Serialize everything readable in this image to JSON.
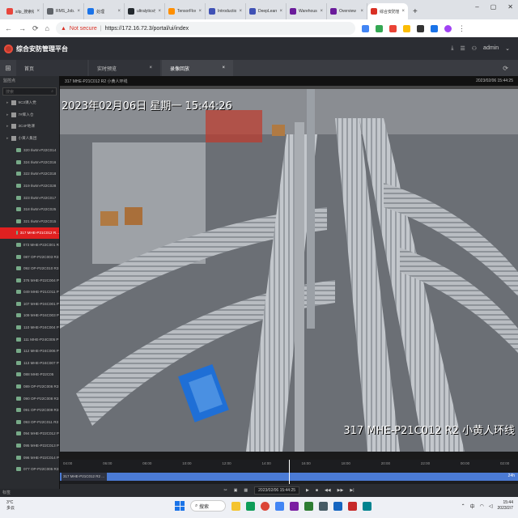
{
  "browser": {
    "tabs": [
      {
        "label": "silp_搜索结果",
        "color": "#e8453c"
      },
      {
        "label": "RMS_Job...",
        "color": "#5f6368"
      },
      {
        "label": "处理",
        "color": "#1a73e8"
      },
      {
        "label": "ultralytics/y...",
        "color": "#24292e"
      },
      {
        "label": "TensorFlow",
        "color": "#ff8f00"
      },
      {
        "label": "Introductio...",
        "color": "#3f51b5"
      },
      {
        "label": "DeepLearni...",
        "color": "#3f51b5"
      },
      {
        "label": "Warehouse...",
        "color": "#6a1b9a"
      },
      {
        "label": "Overview",
        "color": "#6a1b9a"
      },
      {
        "label": "综合安防管理...",
        "color": "#d93025",
        "active": true
      }
    ],
    "not_secure": "Not secure",
    "url": "https://172.16.72.3/portal/ui/index"
  },
  "app": {
    "title": "综合安防管理平台",
    "user": "admin",
    "nav_tabs": [
      {
        "label": "首页"
      },
      {
        "label": "实时预览"
      },
      {
        "label": "录像回放",
        "active": true
      }
    ]
  },
  "sidebar": {
    "title": "监控点",
    "search_placeholder": "搜索",
    "groups": [
      {
        "label": "9C3课入党"
      },
      {
        "label": "7#库入仓"
      },
      {
        "label": "3C4F地课"
      },
      {
        "label": "小黄人集团"
      }
    ],
    "cameras": [
      "320 Ilwtm-P22C014",
      "324 Ilwtm-P22C016",
      "322 Ilwtm-P22C018",
      "319 Ilwtm-P22C028",
      "323 Ilwtm-P22C017",
      "318 Ilwtm-P22C025",
      "321 Ilwtm-P22C015",
      "317 MHE-P21C012 R...",
      "073 MHE-P22C001 R",
      "087 OP-P22C003 R3",
      "092 OP-P22C010 R3",
      "376 MHE-P22C004 P",
      "049 MHE-P21C011 P",
      "107 MHE-P24C001 P",
      "109 MHE-P24C003 P",
      "110 MHE-P24C004 P",
      "111 MHE-P24C005 P",
      "112 MHE-P24C006 P",
      "113 MHE-P24C007 P",
      "088 MHE-P22C05",
      "089 OP-P22C006 R3",
      "090 OP-P22C008 R3",
      "091 OP-P22C009 R3",
      "093 OP-P22C011 R3",
      "094 MHE-P22C012 P",
      "095 MHE-P22C013 P",
      "096 MHE-P22C014 P",
      "077 OP-P22C005 R3"
    ],
    "selected_index": 7,
    "footer": "标签"
  },
  "video": {
    "header_left": "317 MHE-P21C012 R2 小黄人环线",
    "header_right": "2023/02/06 15:44:25",
    "osd_time": "2023年02月06日 星期一 15:44:26",
    "osd_name": "317 MHE-P21C012 R2 小黄人环线"
  },
  "timeline": {
    "label": "317 MHE-P21C012 R2 ...",
    "ticks": [
      "04:00",
      "06:00",
      "08:00",
      "10:00",
      "12:00",
      "14:00",
      "16:00",
      "18:00",
      "20:00",
      "22:00",
      "00:00",
      "02:00"
    ],
    "right_label": "24h",
    "playback_time": "2023/02/06 15:44:25",
    "playhead_position": 0.5
  },
  "taskbar": {
    "weather_temp": "3°C",
    "weather_desc": "多云",
    "search": "搜索",
    "lang": "中",
    "time": "15:44",
    "date": "2023/2/7"
  }
}
